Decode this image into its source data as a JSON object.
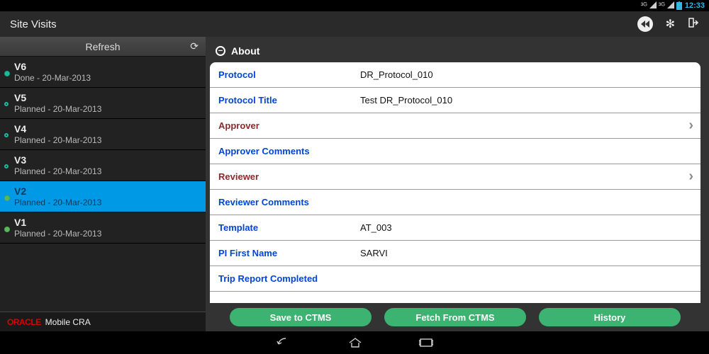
{
  "status": {
    "time": "12:33"
  },
  "appbar": {
    "title": "Site Visits"
  },
  "sidebar": {
    "refresh": "Refresh",
    "visits": [
      {
        "name": "V6",
        "status": "Done - 20-Mar-2013"
      },
      {
        "name": "V5",
        "status": "Planned - 20-Mar-2013"
      },
      {
        "name": "V4",
        "status": "Planned - 20-Mar-2013"
      },
      {
        "name": "V3",
        "status": "Planned - 20-Mar-2013"
      },
      {
        "name": "V2",
        "status": "Planned - 20-Mar-2013"
      },
      {
        "name": "V1",
        "status": "Planned - 20-Mar-2013"
      }
    ],
    "brand": {
      "logo": "ORACLE",
      "product": "Mobile CRA"
    }
  },
  "about": {
    "section": "About",
    "collapse_sym": "−",
    "rows": {
      "protocol_label": "Protocol",
      "protocol_value": "DR_Protocol_010",
      "protocol_title_label": "Protocol Title",
      "protocol_title_value": "Test DR_Protocol_010",
      "approver_label": "Approver",
      "approver_comments_label": "Approver Comments",
      "reviewer_label": "Reviewer",
      "reviewer_comments_label": "Reviewer Comments",
      "template_label": "Template",
      "template_value": "AT_003",
      "pi_first_label": "PI First Name",
      "pi_first_value": "SARVI",
      "trip_report_label": "Trip Report Completed"
    }
  },
  "actions": {
    "save": "Save to CTMS",
    "fetch": "Fetch From CTMS",
    "history": "History"
  }
}
